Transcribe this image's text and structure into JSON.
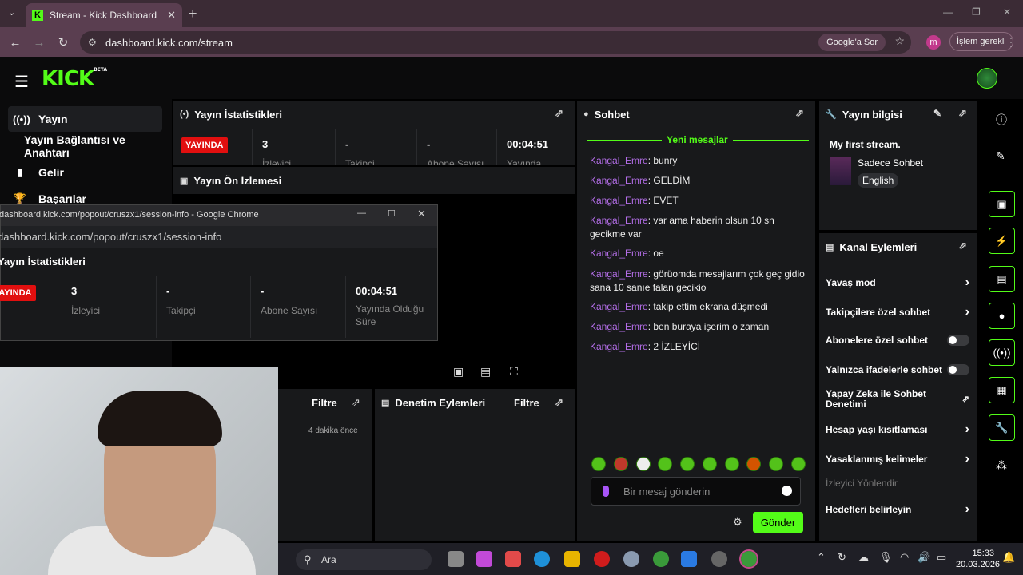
{
  "browser": {
    "tab_title": "Stream - Kick Dashboard",
    "url": "dashboard.kick.com/stream",
    "ask_google": "Google'a Sor",
    "profile_initial": "m",
    "action_required": "İşlem gerekli"
  },
  "app": {
    "logo": "KICK",
    "logo_badge": "BETA"
  },
  "sidebar": {
    "items": [
      {
        "label": "Yayın",
        "icon": "broadcast-icon",
        "active": true
      },
      {
        "label": "Yayın Bağlantısı ve Anahtarı",
        "icon": "",
        "active": false
      },
      {
        "label": "Gelir",
        "icon": "chart-icon",
        "active": false
      },
      {
        "label": "Başarılar",
        "icon": "trophy-icon",
        "active": false
      }
    ]
  },
  "stats_panel": {
    "title": "Yayın İstatistikleri",
    "live_badge": "YAYINDA",
    "viewers": "3",
    "viewers_label": "İzleyici",
    "followers": "-",
    "followers_label": "Takipçi",
    "subs": "-",
    "subs_label": "Abone Sayısı",
    "duration": "00:04:51",
    "duration_label": "Yayında Olduğu Süre"
  },
  "preview_panel": {
    "title": "Yayın Ön İzlemesi"
  },
  "popup": {
    "title": "dashboard.kick.com/popout/cruszx1/session-info - Google Chrome",
    "url": "dashboard.kick.com/popout/cruszx1/session-info",
    "heading": "Yayın İstatistikleri",
    "live_badge": "YAYINDA"
  },
  "activity_panel": {
    "filter": "Filtre",
    "time_ago": "4 dakika önce"
  },
  "moderation_panel": {
    "title": "Denetim Eylemleri",
    "filter": "Filtre"
  },
  "chat": {
    "title": "Sohbet",
    "new_messages": "Yeni mesajlar",
    "messages": [
      {
        "user": "Kangal_Emre",
        "text": ": bunry"
      },
      {
        "user": "Kangal_Emre",
        "text": ": GELDİM"
      },
      {
        "user": "Kangal_Emre",
        "text": ": EVET"
      },
      {
        "user": "Kangal_Emre",
        "text": ": var ama haberin olsun 10 sn gecikme var"
      },
      {
        "user": "Kangal_Emre",
        "text": ": oe"
      },
      {
        "user": "Kangal_Emre",
        "text": ": görüomda mesajlarım çok geç gidio sana 10 sanıe falan gecikio"
      },
      {
        "user": "Kangal_Emre",
        "text": ": takip ettim ekrana düşmedi"
      },
      {
        "user": "Kangal_Emre",
        "text": ": ben buraya işerim o zaman"
      },
      {
        "user": "Kangal_Emre",
        "text": ": 2 İZLEYİCİ"
      }
    ],
    "placeholder": "Bir mesaj gönderin",
    "send": "Gönder"
  },
  "stream_info": {
    "title": "Yayın bilgisi",
    "stream_title": "My first stream.",
    "category": "Sadece Sohbet",
    "language": "English"
  },
  "channel_actions": {
    "title": "Kanal Eylemleri",
    "items": [
      {
        "label": "Yavaş mod",
        "control": "chevron"
      },
      {
        "label": "Takipçilere özel sohbet",
        "control": "chevron"
      },
      {
        "label": "Abonelere özel sohbet",
        "control": "toggle"
      },
      {
        "label": "Yalnızca ifadelerle sohbet",
        "control": "toggle"
      },
      {
        "label": "Yapay Zeka ile Sohbet Denetimi",
        "control": "external"
      },
      {
        "label": "Hesap yaşı kısıtlaması",
        "control": "chevron"
      },
      {
        "label": "Yasaklanmış kelimeler",
        "control": "chevron"
      },
      {
        "label": "İzleyici Yönlendir",
        "control": "none"
      },
      {
        "label": "Hedefleri belirleyin",
        "control": "chevron"
      }
    ]
  },
  "taskbar": {
    "search": "Ara",
    "time": "15:33",
    "date": "20.03.2026"
  },
  "colors": {
    "accent": "#53fc18",
    "live": "#e10f0f",
    "username": "#b46ee8"
  }
}
